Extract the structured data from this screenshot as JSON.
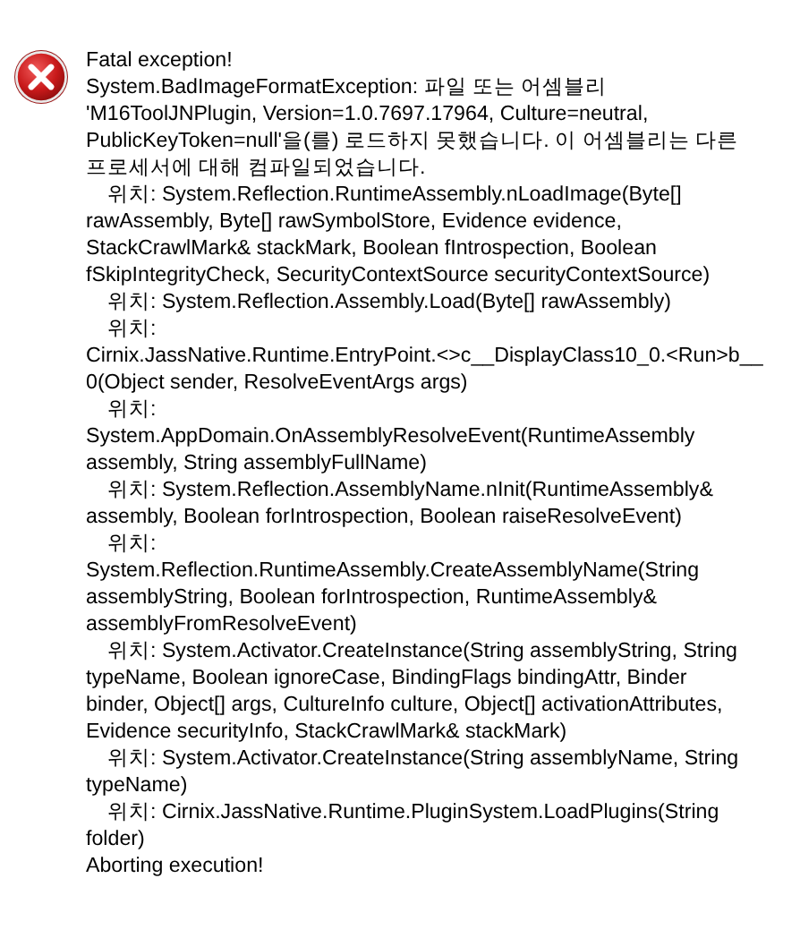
{
  "dialog": {
    "lines": [
      {
        "kind": "text",
        "text": "Fatal exception!"
      },
      {
        "kind": "text",
        "text": "System.BadImageFormatException: 파일 또는 어셈블리"
      },
      {
        "kind": "text",
        "text": "'M16ToolJNPlugin, Version=1.0.7697.17964, Culture=neutral,"
      },
      {
        "kind": "text",
        "text": "PublicKeyToken=null'을(를) 로드하지 못했습니다. 이 어셈블리는 다른"
      },
      {
        "kind": "text",
        "text": "프로세서에 대해 컴파일되었습니다."
      },
      {
        "kind": "frame",
        "text": "위치: System.Reflection.RuntimeAssembly.nLoadImage(Byte[]"
      },
      {
        "kind": "text",
        "text": "rawAssembly, Byte[] rawSymbolStore, Evidence evidence,"
      },
      {
        "kind": "text",
        "text": "StackCrawlMark& stackMark, Boolean fIntrospection, Boolean"
      },
      {
        "kind": "text",
        "text": "fSkipIntegrityCheck, SecurityContextSource securityContextSource)"
      },
      {
        "kind": "frame",
        "text": "위치: System.Reflection.Assembly.Load(Byte[] rawAssembly)"
      },
      {
        "kind": "frame",
        "text": "위치:"
      },
      {
        "kind": "text",
        "text": "Cirnix.JassNative.Runtime.EntryPoint.<>c__DisplayClass10_0.<Run>b__"
      },
      {
        "kind": "text",
        "text": "0(Object sender, ResolveEventArgs args)"
      },
      {
        "kind": "frame",
        "text": "위치:"
      },
      {
        "kind": "text",
        "text": "System.AppDomain.OnAssemblyResolveEvent(RuntimeAssembly"
      },
      {
        "kind": "text",
        "text": "assembly, String assemblyFullName)"
      },
      {
        "kind": "frame",
        "text": "위치: System.Reflection.AssemblyName.nInit(RuntimeAssembly&"
      },
      {
        "kind": "text",
        "text": "assembly, Boolean forIntrospection, Boolean raiseResolveEvent)"
      },
      {
        "kind": "frame",
        "text": "위치:"
      },
      {
        "kind": "text",
        "text": "System.Reflection.RuntimeAssembly.CreateAssemblyName(String"
      },
      {
        "kind": "text",
        "text": "assemblyString, Boolean forIntrospection, RuntimeAssembly&"
      },
      {
        "kind": "text",
        "text": "assemblyFromResolveEvent)"
      },
      {
        "kind": "frame",
        "text": "위치: System.Activator.CreateInstance(String assemblyString, String"
      },
      {
        "kind": "text",
        "text": "typeName, Boolean ignoreCase, BindingFlags bindingAttr, Binder"
      },
      {
        "kind": "text",
        "text": "binder, Object[] args, CultureInfo culture, Object[] activationAttributes,"
      },
      {
        "kind": "text",
        "text": "Evidence securityInfo, StackCrawlMark& stackMark)"
      },
      {
        "kind": "frame",
        "text": "위치: System.Activator.CreateInstance(String assemblyName, String"
      },
      {
        "kind": "text",
        "text": "typeName)"
      },
      {
        "kind": "frame",
        "text": "위치: Cirnix.JassNative.Runtime.PluginSystem.LoadPlugins(String"
      },
      {
        "kind": "text",
        "text": "folder)"
      },
      {
        "kind": "text",
        "text": "Aborting execution!"
      }
    ]
  }
}
